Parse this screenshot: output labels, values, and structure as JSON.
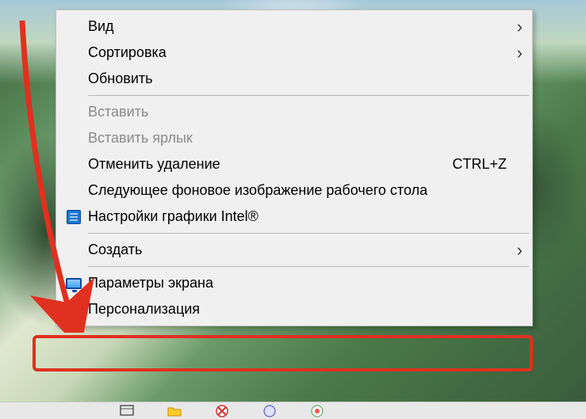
{
  "menu": {
    "items": [
      {
        "label": "Вид",
        "submenu": true
      },
      {
        "label": "Сортировка",
        "submenu": true
      },
      {
        "label": "Обновить"
      },
      {
        "separator": true
      },
      {
        "label": "Вставить",
        "disabled": true
      },
      {
        "label": "Вставить ярлык",
        "disabled": true
      },
      {
        "label": "Отменить удаление",
        "shortcut": "CTRL+Z"
      },
      {
        "label": "Следующее фоновое изображение рабочего стола"
      },
      {
        "label": "Настройки графики Intel®",
        "icon": "intel"
      },
      {
        "separator": true
      },
      {
        "label": "Создать",
        "submenu": true
      },
      {
        "separator": true
      },
      {
        "label": "Параметры экрана",
        "icon": "monitor"
      },
      {
        "label": "Персонализация",
        "icon": "monitor2",
        "highlighted": true
      }
    ]
  },
  "annotation": {
    "arrow_color": "#e03020",
    "highlight_color": "#e03020"
  }
}
